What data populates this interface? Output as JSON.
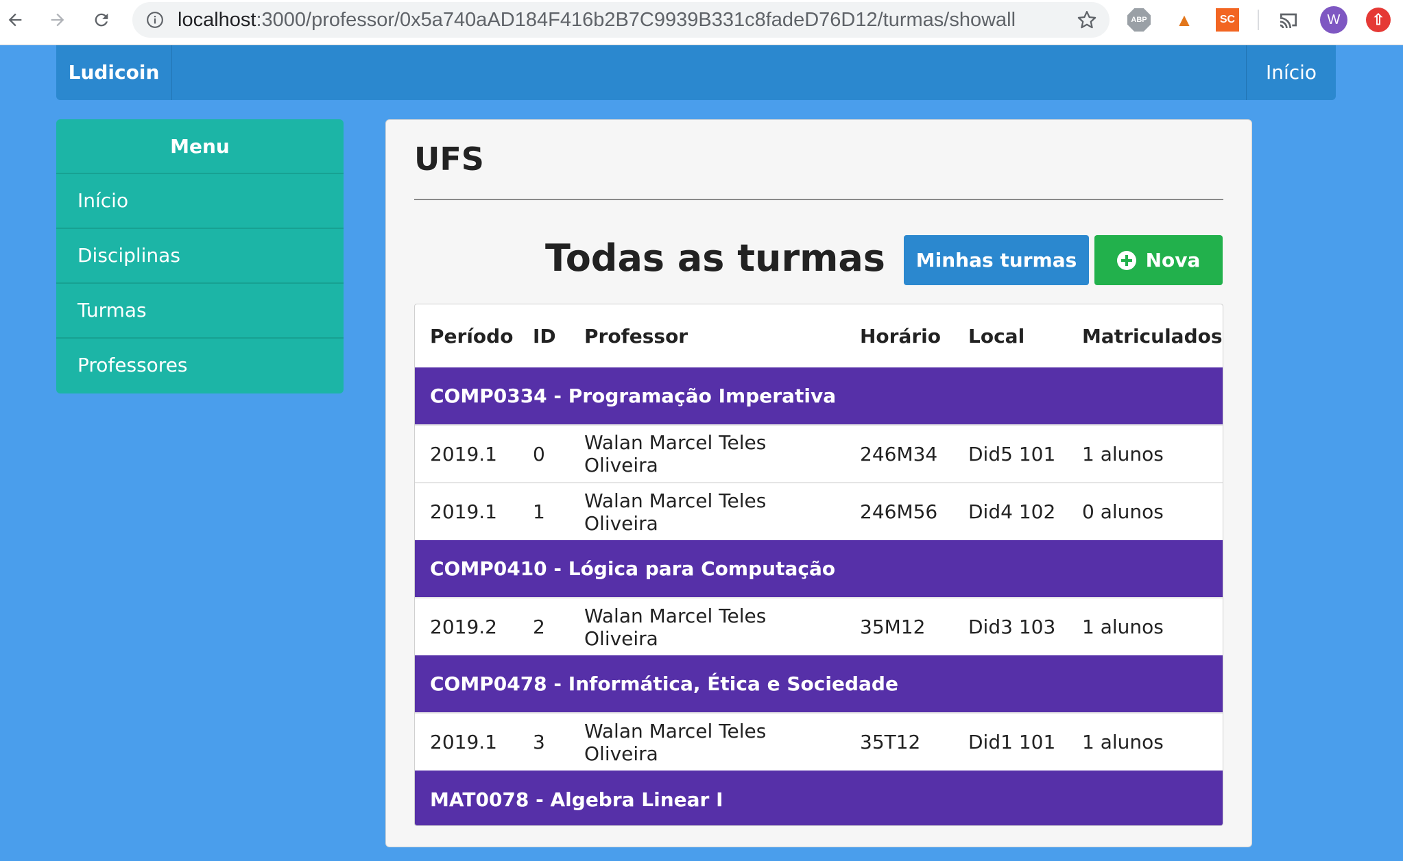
{
  "browser": {
    "url_host": "localhost",
    "url_rest": ":3000/professor/0x5a740aAD184F416b2B7C9939B331c8fadeD76D12/turmas/showall",
    "extensions": [
      "ABP",
      "SC"
    ],
    "avatar_letter": "W"
  },
  "navbar": {
    "brand": "Ludicoin",
    "home": "Início",
    "color": "#2b88cf"
  },
  "sidebar": {
    "title": "Menu",
    "items": [
      {
        "label": "Início"
      },
      {
        "label": "Disciplinas"
      },
      {
        "label": "Turmas"
      },
      {
        "label": "Professores"
      }
    ],
    "color": "#1cb5a6"
  },
  "main": {
    "title": "UFS",
    "section_title": "Todas as turmas",
    "btn_minhas": "Minhas turmas",
    "btn_nova": "Nova",
    "group_color": "#5630a8",
    "columns": [
      "Período",
      "ID",
      "Professor",
      "Horário",
      "Local",
      "Matriculados"
    ],
    "groups": [
      {
        "name": "COMP0334 - Programação Imperativa",
        "rows": [
          [
            "2019.1",
            "0",
            "Walan Marcel Teles Oliveira",
            "246M34",
            "Did5 101",
            "1 alunos"
          ],
          [
            "2019.1",
            "1",
            "Walan Marcel Teles Oliveira",
            "246M56",
            "Did4 102",
            "0 alunos"
          ]
        ]
      },
      {
        "name": "COMP0410 - Lógica para Computação",
        "rows": [
          [
            "2019.2",
            "2",
            "Walan Marcel Teles Oliveira",
            "35M12",
            "Did3 103",
            "1 alunos"
          ]
        ]
      },
      {
        "name": "COMP0478 - Informática, Ética e Sociedade",
        "rows": [
          [
            "2019.1",
            "3",
            "Walan Marcel Teles Oliveira",
            "35T12",
            "Did1 101",
            "1 alunos"
          ]
        ]
      },
      {
        "name": "MAT0078 - Algebra Linear I",
        "rows": []
      }
    ]
  }
}
